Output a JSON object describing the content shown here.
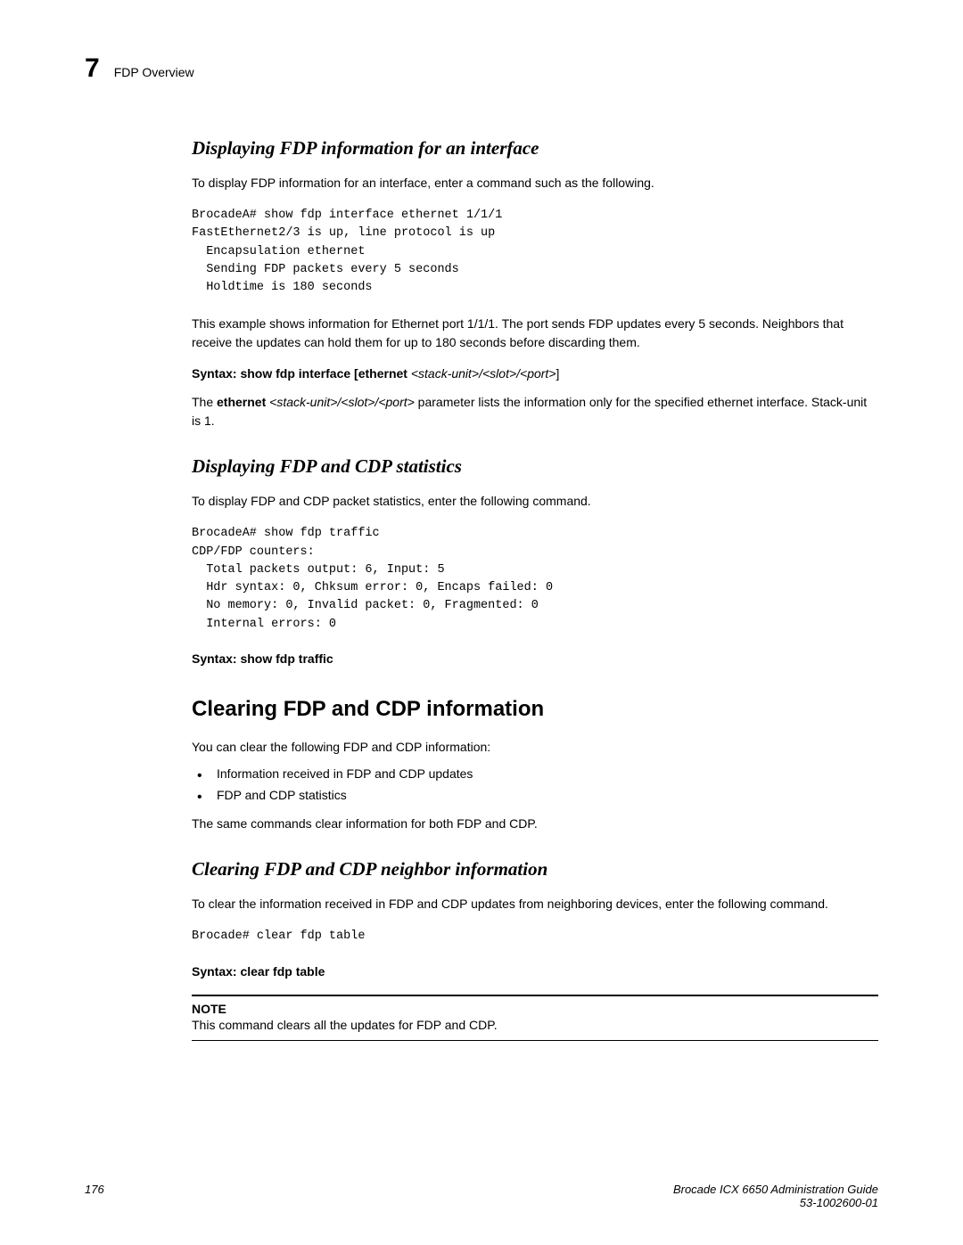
{
  "header": {
    "chapter_num": "7",
    "chapter_title": "FDP Overview"
  },
  "section1": {
    "title": "Displaying FDP information for an interface",
    "intro": "To display FDP information for an interface, enter a command such as the following.",
    "code": "BrocadeA# show fdp interface ethernet 1/1/1\nFastEthernet2/3 is up, line protocol is up\n  Encapsulation ethernet\n  Sending FDP packets every 5 seconds\n  Holdtime is 180 seconds",
    "explain": "This example shows information for Ethernet port 1/1/1.  The port sends FDP updates every 5 seconds.  Neighbors that receive the updates can hold them for up to 180 seconds before discarding them.",
    "syntax_label": "Syntax:",
    "syntax_cmd": "show fdp interface",
    "syntax_optional_prefix": "[ethernet ",
    "syntax_params": "<stack-unit>/<slot>/<port>",
    "syntax_suffix": "]",
    "param_prefix": "The ",
    "param_ethernet": "ethernet ",
    "param_args": "<stack-unit>/<slot>/<port>",
    "param_desc": " parameter lists the information only for the specified ethernet interface. Stack-unit is 1."
  },
  "section2": {
    "title": "Displaying FDP and CDP statistics",
    "intro": "To display FDP and CDP packet statistics, enter the following command.",
    "code": "BrocadeA# show fdp traffic\nCDP/FDP counters:\n  Total packets output: 6, Input: 5\n  Hdr syntax: 0, Chksum error: 0, Encaps failed: 0\n  No memory: 0, Invalid packet: 0, Fragmented: 0\n  Internal errors: 0",
    "syntax_label": "Syntax:",
    "syntax_cmd": "show fdp traffic"
  },
  "section3": {
    "title": "Clearing FDP and CDP information",
    "intro": "You can clear the following FDP and CDP information:",
    "bullets": [
      "Information received in FDP and CDP updates",
      "FDP and CDP statistics"
    ],
    "after": "The same commands clear information for both FDP and CDP."
  },
  "section4": {
    "title": "Clearing FDP and CDP neighbor information",
    "intro": "To clear the information received in FDP and CDP updates from neighboring devices, enter the following command.",
    "code": "Brocade# clear fdp table",
    "syntax_label": "Syntax:",
    "syntax_cmd": "clear fdp table",
    "note_label": "NOTE",
    "note_text": "This command clears all the updates for FDP and CDP."
  },
  "footer": {
    "page": "176",
    "guide": "Brocade ICX 6650 Administration Guide",
    "docnum": "53-1002600-01"
  }
}
